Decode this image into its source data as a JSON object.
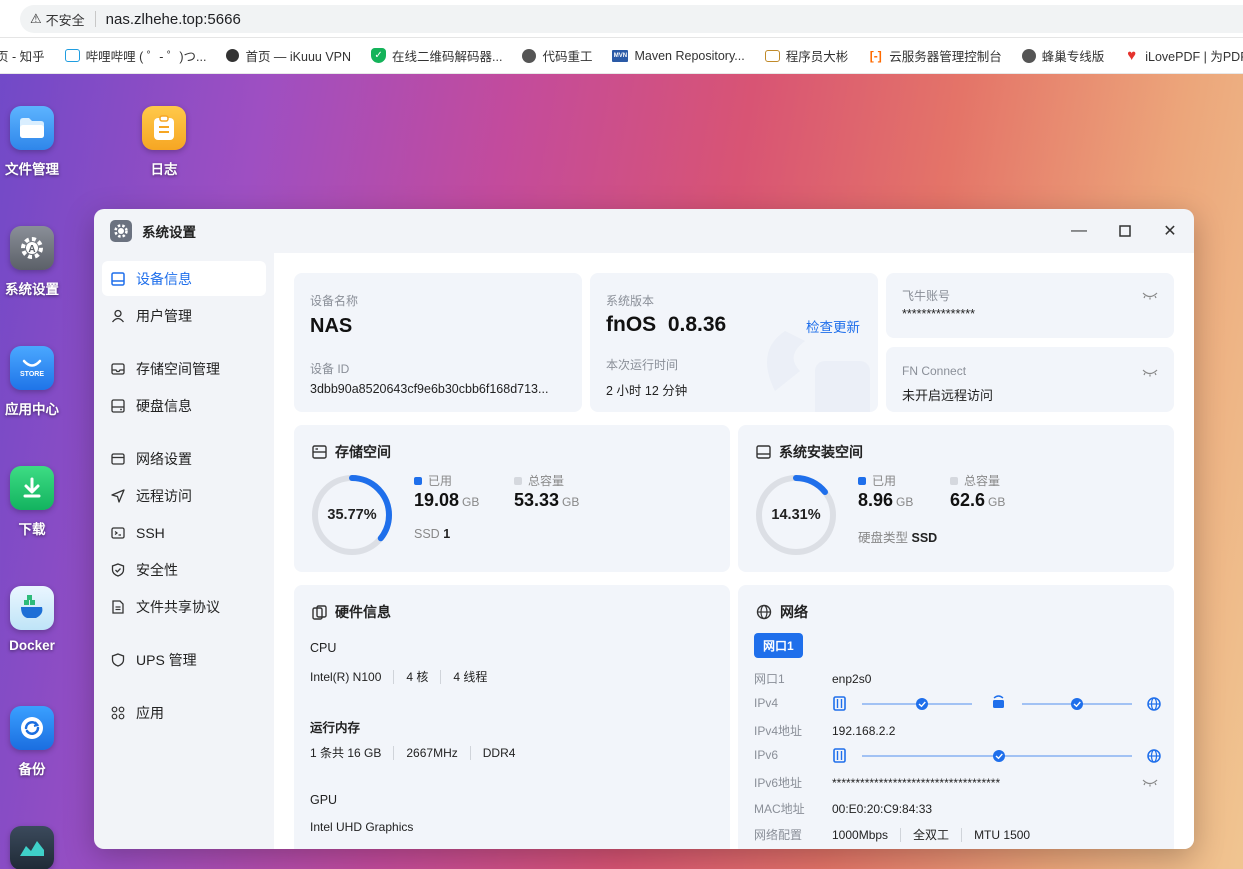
{
  "browser": {
    "insecure_label": "不安全",
    "url": "nas.zlhehe.top:5666",
    "bookmarks": [
      {
        "label": "页 - 知乎",
        "icon": "page-icon",
        "color": "#ffffff"
      },
      {
        "label": "哔哩哔哩 ( ゜- ゜)つ...",
        "icon": "tv-icon",
        "color": "#1f9de0"
      },
      {
        "label": "首页 — iKuuu VPN",
        "icon": "cat-icon",
        "color": "#333333"
      },
      {
        "label": "在线二维码解码器...",
        "icon": "shield-icon",
        "color": "#14b35a"
      },
      {
        "label": "代码重工",
        "icon": "globe-icon",
        "color": "#555555"
      },
      {
        "label": "Maven Repository...",
        "icon": "mvn-icon",
        "color": "#2b5aa6"
      },
      {
        "label": "程序员大彬",
        "icon": "card-icon",
        "color": "#c08a2a"
      },
      {
        "label": "云服务器管理控制台",
        "icon": "cloud-icon",
        "color": "#ff6a00"
      },
      {
        "label": "蜂巢专线版",
        "icon": "globe-icon",
        "color": "#555555"
      },
      {
        "label": "iLovePDF | 为PDF...",
        "icon": "heart-icon",
        "color": "#e5322d"
      }
    ]
  },
  "desktop": {
    "icons": [
      {
        "label": "文件管理",
        "icon": "folder-icon"
      },
      {
        "label": "日志",
        "icon": "log-icon"
      },
      {
        "label": "系统设置",
        "icon": "settings-icon"
      },
      {
        "label": "应用中心",
        "icon": "store-icon",
        "badge": "STORE"
      },
      {
        "label": "下载",
        "icon": "download-icon"
      },
      {
        "label": "Docker",
        "icon": "docker-icon"
      },
      {
        "label": "备份",
        "icon": "backup-icon"
      }
    ]
  },
  "window": {
    "title": "系统设置",
    "sidebar": [
      {
        "label": "设备信息",
        "icon": "device-icon",
        "active": true
      },
      {
        "label": "用户管理",
        "icon": "user-icon"
      },
      {
        "label": "存储空间管理",
        "icon": "storage-icon"
      },
      {
        "label": "硬盘信息",
        "icon": "disk-icon"
      },
      {
        "label": "网络设置",
        "icon": "network-icon"
      },
      {
        "label": "远程访问",
        "icon": "send-icon"
      },
      {
        "label": "SSH",
        "icon": "terminal-icon"
      },
      {
        "label": "安全性",
        "icon": "shield-check-icon"
      },
      {
        "label": "文件共享协议",
        "icon": "file-share-icon"
      },
      {
        "label": "UPS 管理",
        "icon": "ups-icon"
      },
      {
        "label": "应用",
        "icon": "apps-icon"
      }
    ],
    "device": {
      "name_label": "设备名称",
      "name": "NAS",
      "id_label": "设备 ID",
      "id": "3dbb90a8520643cf9e6b30cbb6f168d713..."
    },
    "system": {
      "version_label": "系统版本",
      "version": "fnOS  0.8.36",
      "check_update": "检查更新",
      "uptime_label": "本次运行时间",
      "uptime": "2 小时 12 分钟"
    },
    "account": {
      "label": "飞牛账号",
      "value": "***************"
    },
    "fn_connect": {
      "label": "FN Connect",
      "value": "未开启远程访问"
    },
    "storage": {
      "title": "存储空间",
      "percent": "35.77%",
      "percent_value": 0.3577,
      "used_label": "已用",
      "used": "19.08",
      "used_unit": "GB",
      "total_label": "总容量",
      "total": "53.33",
      "total_unit": "GB",
      "ssd_label": "SSD",
      "ssd_count": "1"
    },
    "sys_storage": {
      "title": "系统安装空间",
      "percent": "14.31%",
      "percent_value": 0.1431,
      "used_label": "已用",
      "used": "8.96",
      "used_unit": "GB",
      "total_label": "总容量",
      "total": "62.6",
      "total_unit": "GB",
      "disk_type_label": "硬盘类型",
      "disk_type": "SSD"
    },
    "hardware": {
      "title": "硬件信息",
      "cpu_label": "CPU",
      "cpu_model": "Intel(R) N100",
      "cpu_cores": "4 核",
      "cpu_threads": "4 线程",
      "mem_label": "运行内存",
      "mem_size": "1 条共 16 GB",
      "mem_freq": "2667MHz",
      "mem_type": "DDR4",
      "gpu_label": "GPU",
      "gpu_model": "Intel UHD Graphics"
    },
    "network": {
      "title": "网络",
      "tab": "网口1",
      "port_label": "网口1",
      "port": "enp2s0",
      "ipv4_label": "IPv4",
      "ipv4_addr_label": "IPv4地址",
      "ipv4_addr": "192.168.2.2",
      "ipv6_label": "IPv6",
      "ipv6_addr_label": "IPv6地址",
      "ipv6_addr": "************************************",
      "mac_label": "MAC地址",
      "mac": "00:E0:20:C9:84:33",
      "config_label": "网络配置",
      "speed": "1000Mbps",
      "duplex": "全双工",
      "mtu": "MTU 1500"
    },
    "accent": "#1f6feb"
  }
}
